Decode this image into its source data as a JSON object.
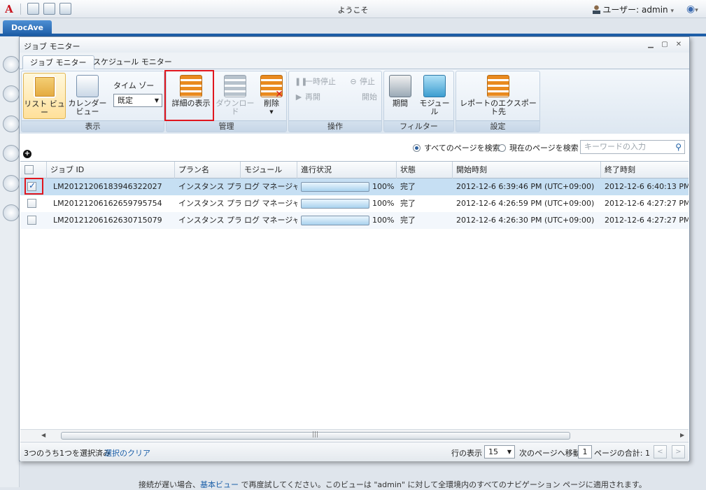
{
  "topbar": {
    "welcome": "ようこそ",
    "user_label": "ユーザー: admin",
    "user_caret": "▾",
    "globe_caret": "▾",
    "logo_glyph": "A"
  },
  "app_tab": "DocAve",
  "window": {
    "title": "ジョブ モニター",
    "minimize_glyph": "▁",
    "maximize_glyph": "▢",
    "close_glyph": "✕"
  },
  "tabs": [
    {
      "label": "ジョブ モニター",
      "active": true
    },
    {
      "label": "スケジュール モニター",
      "active": false
    }
  ],
  "ribbon": {
    "groups": {
      "view": "表示",
      "manage": "管理",
      "operation": "操作",
      "filter": "フィルター",
      "settings": "設定"
    },
    "list_view": "リスト ビュー",
    "calendar_view_1": "カレンダー",
    "calendar_view_2": "ビュー",
    "timezone_label": "タイム ゾーン:",
    "timezone_value": "既定",
    "view_details": "詳細の表示",
    "download": "ダウンロード",
    "delete": "削除",
    "pause": "一時停止",
    "stop": "停止",
    "resume": "再開",
    "start": "開始",
    "period": "期間",
    "module": "モジュール",
    "report_export": "レポートのエクスポート先"
  },
  "search": {
    "all_pages": "すべてのページを検索",
    "current_page": "現在のページを検索",
    "placeholder": "キーワードの入力"
  },
  "table": {
    "columns": [
      "ジョブ ID",
      "プラン名",
      "モジュール",
      "進行状況",
      "状態",
      "開始時刻",
      "終了時刻"
    ],
    "rows": [
      {
        "checked": true,
        "job_id": "LM20121206183946322027",
        "plan": "インスタンス プラン",
        "module": "ログ マネージャー",
        "progress": "100%",
        "progress_value": 1.0,
        "status": "完了",
        "start": "2012-12-6 6:39:46 PM (UTC+09:00)",
        "end": "2012-12-6 6:40:13 PM"
      },
      {
        "checked": false,
        "job_id": "LM20121206162659795754",
        "plan": "インスタンス プラン",
        "module": "ログ マネージャー",
        "progress": "100%",
        "progress_value": 1.0,
        "status": "完了",
        "start": "2012-12-6 4:26:59 PM (UTC+09:00)",
        "end": "2012-12-6 4:27:27 PM"
      },
      {
        "checked": false,
        "job_id": "LM20121206162630715079",
        "plan": "インスタンス プラン",
        "module": "ログ マネージャー",
        "progress": "100%",
        "progress_value": 1.0,
        "status": "完了",
        "start": "2012-12-6 4:26:30 PM (UTC+09:00)",
        "end": "2012-12-6 4:27:27 PM"
      }
    ]
  },
  "footer": {
    "selection": "3つのうち1つを選択済み",
    "clear": "選択のクリア",
    "rows_label": "行の表示",
    "rows_value": "15",
    "goto_label": "次のページへ移動",
    "goto_value": "1",
    "total_label": "ページの合計: 1",
    "prev": "<",
    "next": ">"
  },
  "bottom_message": {
    "part1": "接続が遅い場合、",
    "link": "基本ビュー",
    "part2": " で再度試してください。このビューは \"admin\" に対して全環境内のすべてのナビゲーション ページに適用されます。"
  },
  "colors": {
    "accent": "#1f5fa8",
    "highlight_box": "#e0161e",
    "selected_row": "#c6dff3"
  }
}
